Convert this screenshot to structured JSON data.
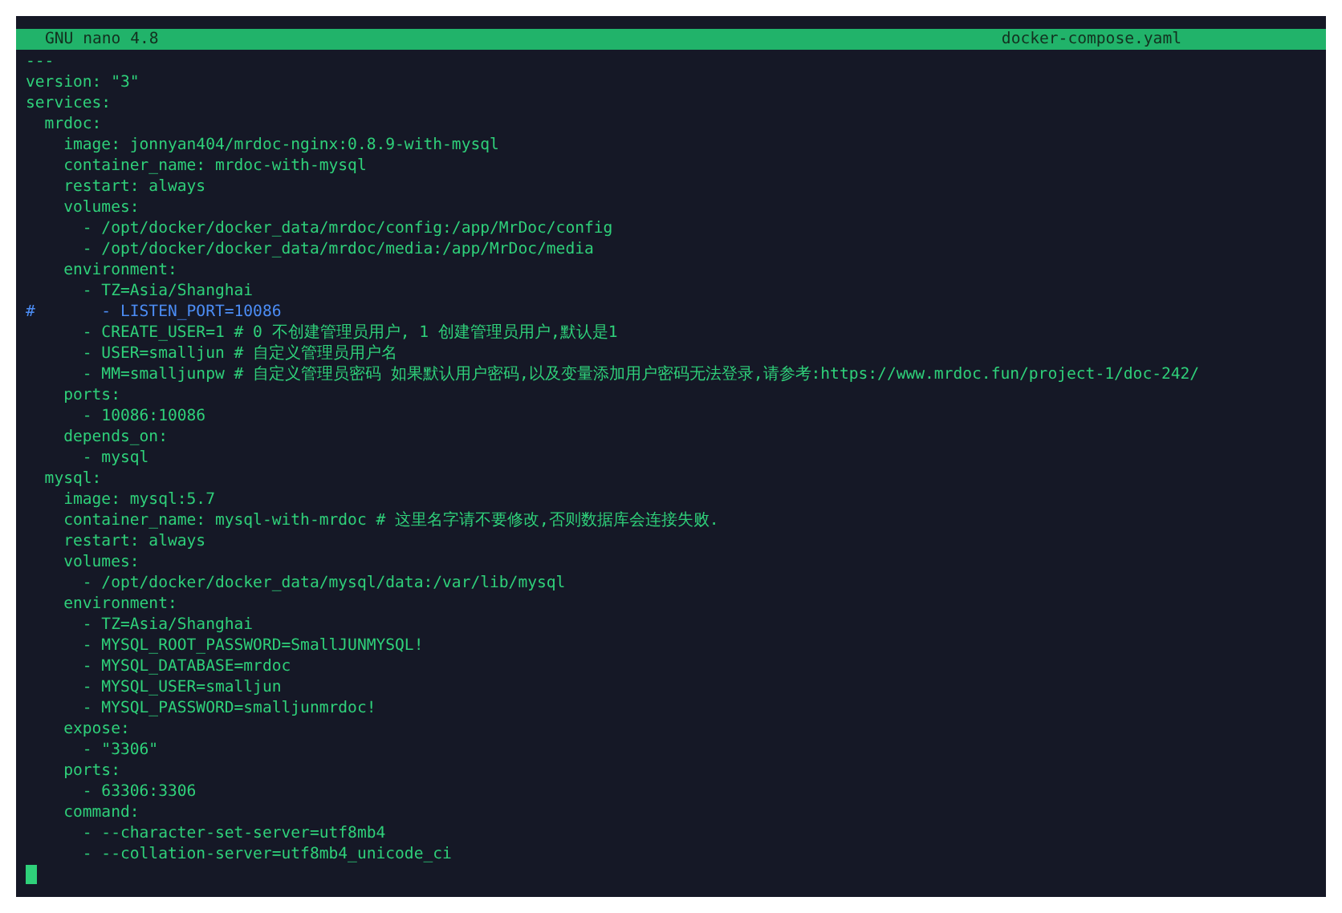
{
  "title_bar": {
    "app": "GNU nano 4.8",
    "filename": "docker-compose.yaml"
  },
  "lines": [
    {
      "kind": "code",
      "text": "---"
    },
    {
      "kind": "code",
      "text": "version: \"3\""
    },
    {
      "kind": "code",
      "text": "services:"
    },
    {
      "kind": "code",
      "text": "  mrdoc:"
    },
    {
      "kind": "code",
      "text": "    image: jonnyan404/mrdoc-nginx:0.8.9-with-mysql"
    },
    {
      "kind": "code",
      "text": "    container_name: mrdoc-with-mysql"
    },
    {
      "kind": "code",
      "text": "    restart: always"
    },
    {
      "kind": "code",
      "text": "    volumes:"
    },
    {
      "kind": "code",
      "text": "      - /opt/docker/docker_data/mrdoc/config:/app/MrDoc/config"
    },
    {
      "kind": "code",
      "text": "      - /opt/docker/docker_data/mrdoc/media:/app/MrDoc/media"
    },
    {
      "kind": "code",
      "text": "    environment:"
    },
    {
      "kind": "code",
      "text": "      - TZ=Asia/Shanghai"
    },
    {
      "kind": "comment",
      "text": "#       - LISTEN_PORT=10086"
    },
    {
      "kind": "code",
      "text": "      - CREATE_USER=1 # 0 不创建管理员用户, 1 创建管理员用户,默认是1"
    },
    {
      "kind": "code",
      "text": "      - USER=smalljun # 自定义管理员用户名"
    },
    {
      "kind": "code",
      "text": "      - MM=smalljunpw # 自定义管理员密码 如果默认用户密码,以及变量添加用户密码无法登录,请参考:https://www.mrdoc.fun/project-1/doc-242/"
    },
    {
      "kind": "code",
      "text": "    ports:"
    },
    {
      "kind": "code",
      "text": "      - 10086:10086"
    },
    {
      "kind": "code",
      "text": "    depends_on:"
    },
    {
      "kind": "code",
      "text": "      - mysql"
    },
    {
      "kind": "code",
      "text": "  mysql:"
    },
    {
      "kind": "code",
      "text": "    image: mysql:5.7"
    },
    {
      "kind": "code",
      "text": "    container_name: mysql-with-mrdoc # 这里名字请不要修改,否则数据库会连接失败."
    },
    {
      "kind": "code",
      "text": "    restart: always"
    },
    {
      "kind": "code",
      "text": "    volumes:"
    },
    {
      "kind": "code",
      "text": "      - /opt/docker/docker_data/mysql/data:/var/lib/mysql"
    },
    {
      "kind": "code",
      "text": "    environment:"
    },
    {
      "kind": "code",
      "text": "      - TZ=Asia/Shanghai"
    },
    {
      "kind": "code",
      "text": "      - MYSQL_ROOT_PASSWORD=SmallJUNMYSQL!"
    },
    {
      "kind": "code",
      "text": "      - MYSQL_DATABASE=mrdoc"
    },
    {
      "kind": "code",
      "text": "      - MYSQL_USER=smalljun"
    },
    {
      "kind": "code",
      "text": "      - MYSQL_PASSWORD=smalljunmrdoc!"
    },
    {
      "kind": "code",
      "text": "    expose:"
    },
    {
      "kind": "code",
      "text": "      - \"3306\""
    },
    {
      "kind": "code",
      "text": "    ports:"
    },
    {
      "kind": "code",
      "text": "      - 63306:3306"
    },
    {
      "kind": "code",
      "text": "    command:"
    },
    {
      "kind": "code",
      "text": "      - --character-set-server=utf8mb4"
    },
    {
      "kind": "code",
      "text": "      - --collation-server=utf8mb4_unicode_ci"
    }
  ]
}
